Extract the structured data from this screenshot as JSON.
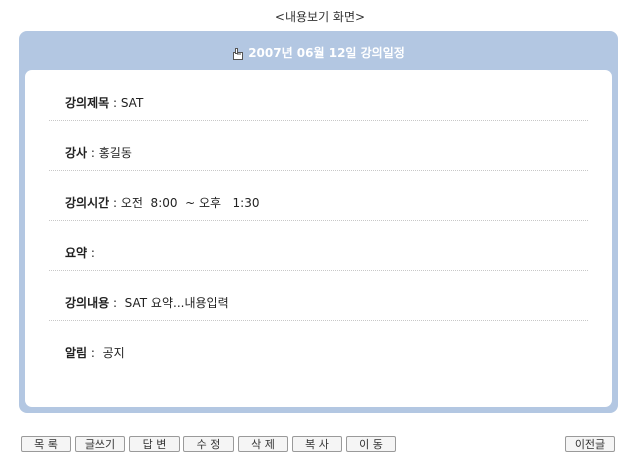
{
  "page_caption": "<내용보기 화면>",
  "panel": {
    "icon": "hand-pointer-icon",
    "title": "2007년 06월 12일 강의일정"
  },
  "fields": [
    {
      "label": "강의제목",
      "sep": " : ",
      "value": "SAT"
    },
    {
      "label": "강사",
      "sep": " : ",
      "value": "홍길동"
    },
    {
      "label": "강의시간",
      "sep": " : ",
      "value": "오전  8:00  ~ 오후   1:30"
    },
    {
      "label": "요약",
      "sep": " : ",
      "value": ""
    },
    {
      "label": "강의내용",
      "sep": " :  ",
      "value": "SAT 요약...내용입력"
    },
    {
      "label": "알림",
      "sep": " :  ",
      "value": "공지"
    }
  ],
  "buttons": {
    "list": "목 록",
    "write": "글쓰기",
    "reply": "답 변",
    "edit": "수 정",
    "delete": "삭 제",
    "copy": "복 사",
    "move": "이 동",
    "prev": "이전글"
  },
  "colors": {
    "panel_border": "#b3c7e2",
    "title_text": "#ffffff"
  }
}
